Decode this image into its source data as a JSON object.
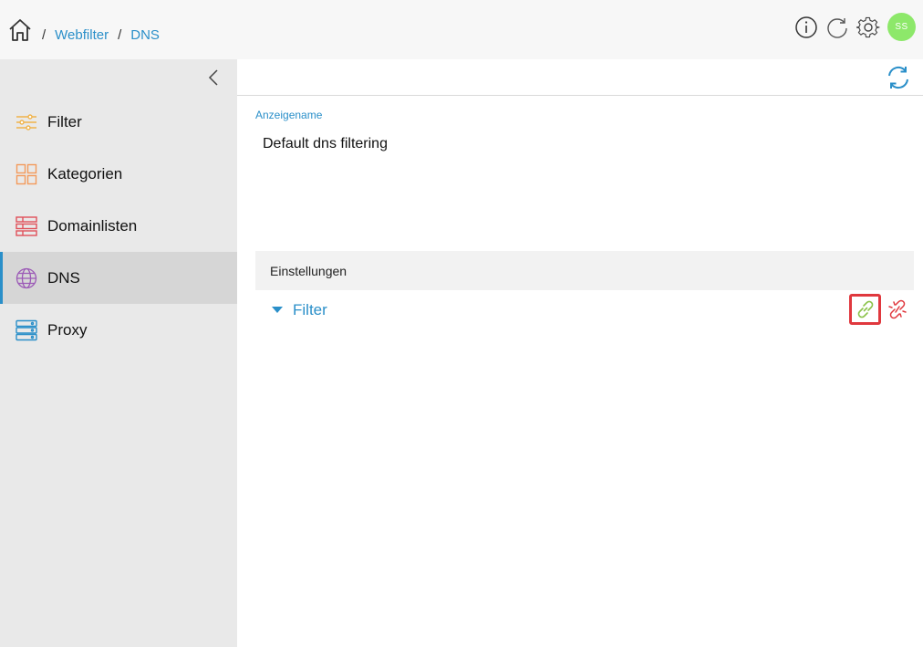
{
  "breadcrumb": {
    "separator": "/",
    "items": [
      {
        "label": "Webfilter"
      },
      {
        "label": "DNS"
      }
    ]
  },
  "topbar": {
    "avatar_initials": "SS",
    "icons": [
      "home-icon",
      "info-icon",
      "reload-icon",
      "gear-icon"
    ]
  },
  "sidebar": {
    "items": [
      {
        "label": "Filter",
        "icon": "sliders-icon",
        "color": "#f0b34a"
      },
      {
        "label": "Kategorien",
        "icon": "grid-icon",
        "color": "#f39a5b"
      },
      {
        "label": "Domainlisten",
        "icon": "list-icon",
        "color": "#e0515a"
      },
      {
        "label": "DNS",
        "icon": "globe-icon",
        "color": "#9b59b6",
        "active": true
      },
      {
        "label": "Proxy",
        "icon": "server-icon",
        "color": "#2a8fc9"
      }
    ]
  },
  "main": {
    "field_label": "Anzeigename",
    "field_value": "Default dns filtering",
    "section_title": "Einstellungen",
    "filter_label": "Filter"
  },
  "colors": {
    "accent": "#2a8fc9",
    "avatar": "#8de86a",
    "link_ok": "#8bc34a",
    "link_remove": "#e0383e"
  }
}
